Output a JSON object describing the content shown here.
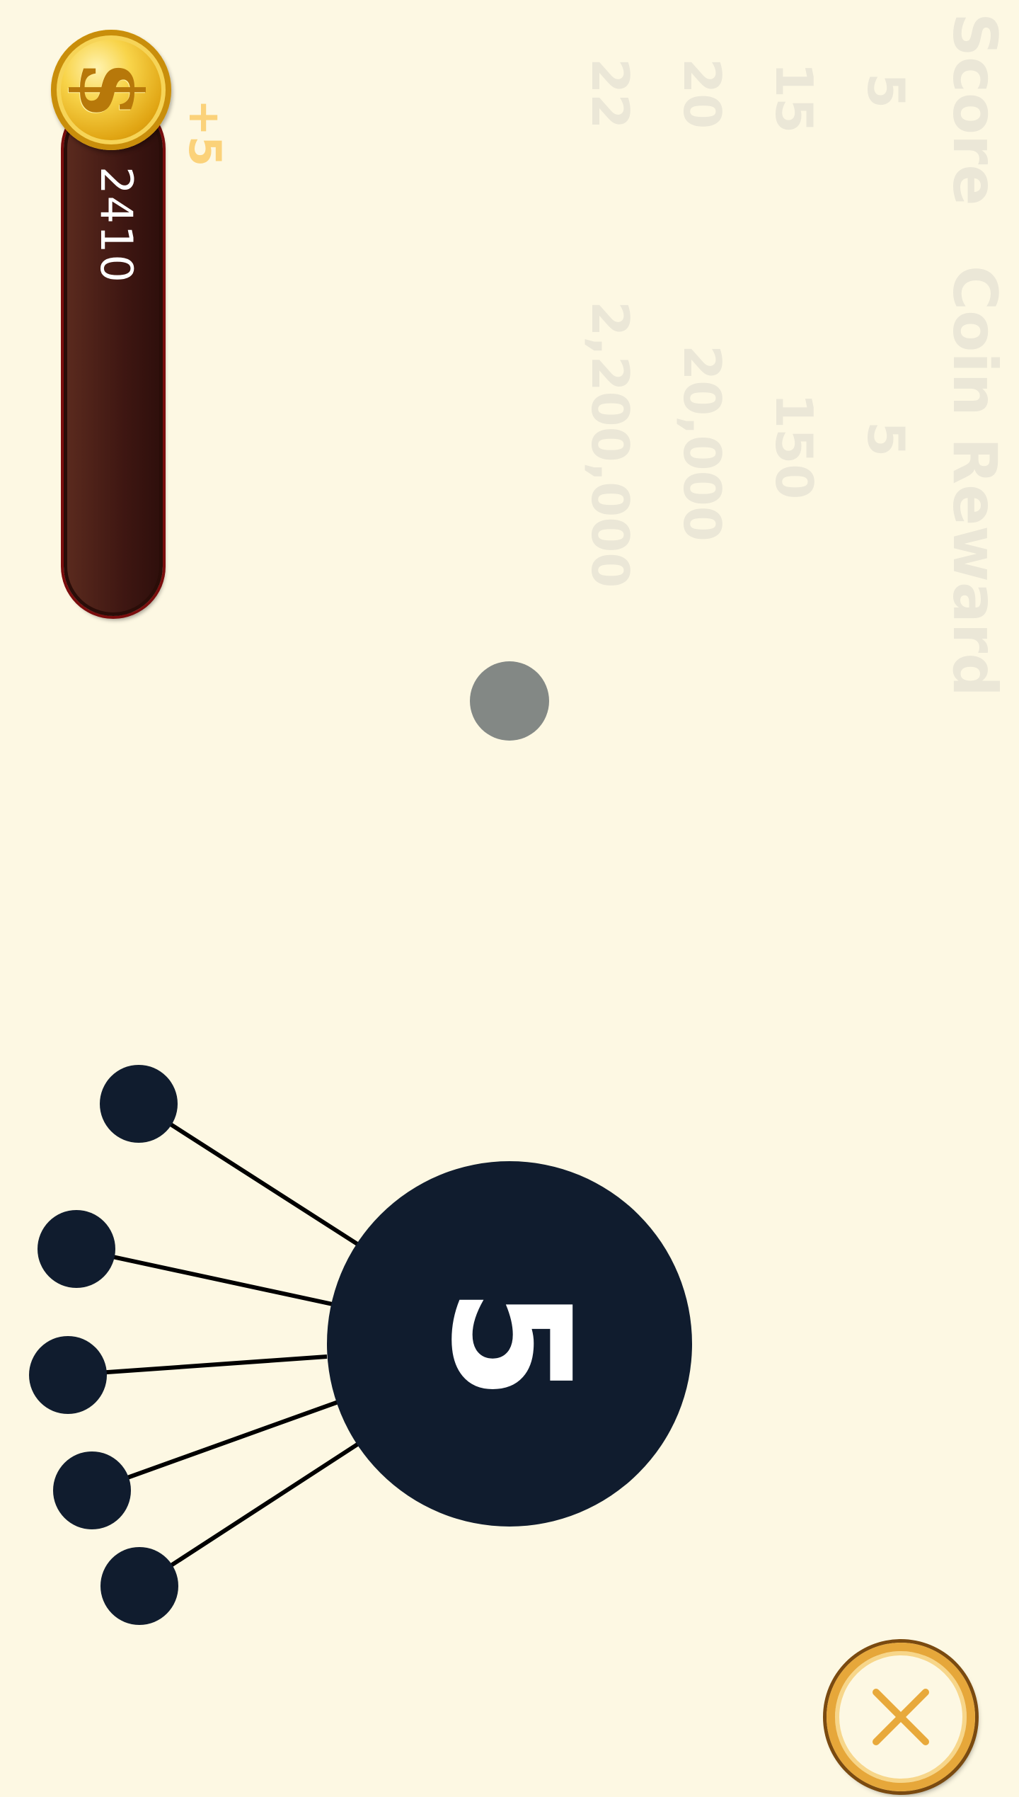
{
  "reward_table": {
    "score_header": "Score",
    "coin_header": "Coin Reward",
    "rows": [
      {
        "score": "5",
        "coins": "5"
      },
      {
        "score": "15",
        "coins": "150"
      },
      {
        "score": "20",
        "coins": "20,000"
      },
      {
        "score": "22",
        "coins": "2,200,000"
      }
    ]
  },
  "hud": {
    "coin_count": "2410",
    "coin_gain": "+5",
    "coin_icon": "dollar-coin-icon",
    "coin_symbol": "$"
  },
  "game": {
    "level_number": "5",
    "pins_attached": 5,
    "colors": {
      "background": "#fdf8e3",
      "hub": "#101c2e",
      "pin": "#101c2e",
      "projectile": "#838885",
      "coin_bar": "#3f1712",
      "close_ring": "#e6a73a"
    }
  },
  "close_button": {
    "icon": "close-icon"
  }
}
